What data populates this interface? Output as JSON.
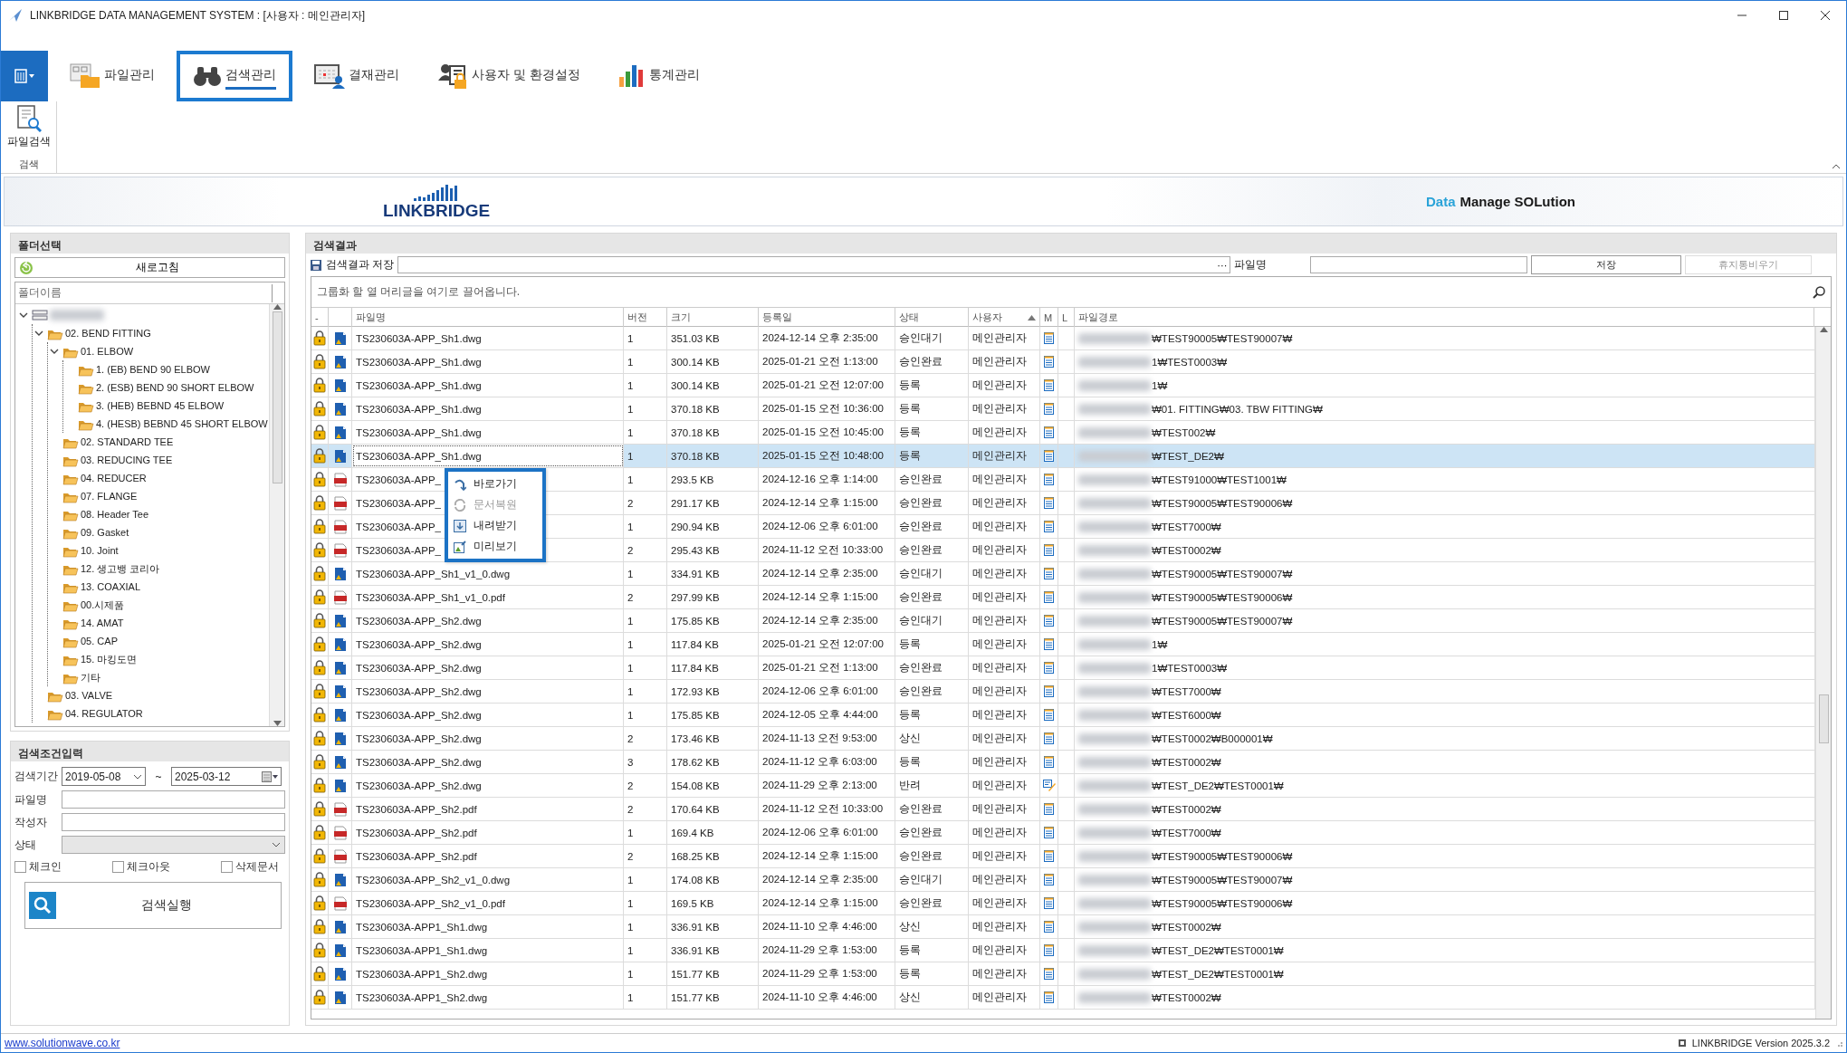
{
  "window": {
    "title": "LINKBRIDGE DATA MANAGEMENT SYSTEM : [사용자 : 메인관리자]"
  },
  "ribbon": {
    "tabs": [
      {
        "label": "파일관리",
        "kind": "files",
        "selected": false
      },
      {
        "label": "검색관리",
        "kind": "search",
        "selected": true
      },
      {
        "label": "결재관리",
        "kind": "approval",
        "selected": false
      },
      {
        "label": "사용자 및 환경설정",
        "kind": "users",
        "selected": false
      },
      {
        "label": "통계관리",
        "kind": "stats",
        "selected": false
      }
    ],
    "buttons": [
      {
        "label": "파일검색"
      }
    ],
    "group_label": "검색"
  },
  "banner": {
    "logo_text": "LINKBRIDGE",
    "tagline_prefix": "Data",
    "tagline": "Manage SOLution"
  },
  "folder_panel": {
    "title": "폴더선택",
    "refresh_button": "새로고침",
    "column_header": "폴더이름",
    "tree": [
      {
        "expanded": true,
        "children": [
          {
            "label": "02. BEND FITTING",
            "expanded": true,
            "children": [
              {
                "label": "01. ELBOW",
                "expanded": true,
                "children": [
                  {
                    "label": "1. (EB) BEND 90 ELBOW"
                  },
                  {
                    "label": "2. (ESB) BEND 90 SHORT ELBOW"
                  },
                  {
                    "label": "3. (HEB) BEBND 45 ELBOW"
                  },
                  {
                    "label": "4. (HESB) BEBND 45 SHORT ELBOW"
                  }
                ]
              },
              {
                "label": "02. STANDARD TEE"
              },
              {
                "label": "03. REDUCING TEE"
              },
              {
                "label": "04. REDUCER"
              },
              {
                "label": "07. FLANGE"
              },
              {
                "label": "08. Header Tee"
              },
              {
                "label": "09. Gasket"
              },
              {
                "label": "10. Joint"
              },
              {
                "label": "12. 생고뱅 코리아"
              },
              {
                "label": "13. COAXIAL"
              },
              {
                "label": "00.시제품"
              },
              {
                "label": "14. AMAT"
              },
              {
                "label": "05. CAP"
              },
              {
                "label": "15. 마킹도면"
              },
              {
                "label": "기타"
              }
            ]
          },
          {
            "label": "03. VALVE"
          },
          {
            "label": "04. REGULATOR"
          }
        ]
      }
    ]
  },
  "search_panel": {
    "title": "검색조건입력",
    "period_label": "검색기간",
    "date_from": "2019-05-08",
    "tilde": "~",
    "date_to": "2025-03-12",
    "filename_label": "파일명",
    "author_label": "작성자",
    "status_label": "상태",
    "status_disabled": true,
    "checkboxes": [
      {
        "label": "체크인",
        "checked": false
      },
      {
        "label": "체크아웃",
        "checked": false
      },
      {
        "label": "삭제문서",
        "checked": false
      }
    ],
    "run_button": "검색실행"
  },
  "results": {
    "title": "검색결과",
    "save_label": "검색결과 저장",
    "browse_button": "···",
    "filename_label": "파일명",
    "save_button": "저장",
    "empty_trash_button": "휴지통비우기",
    "empty_trash_disabled": true,
    "group_hint": "그룹화 할 열 머리글을 여기로 끌어옵니다.",
    "columns": [
      {
        "label": "-"
      },
      {
        "label": "파일명"
      },
      {
        "label": "버전"
      },
      {
        "label": "크기"
      },
      {
        "label": "등록일"
      },
      {
        "label": "상태"
      },
      {
        "label": "사용자",
        "sorted_ascending": true
      },
      {
        "label": "M"
      },
      {
        "label": "L"
      },
      {
        "label": "파일경로"
      }
    ],
    "rows": [
      {
        "kind": "dwg",
        "name": "TS230603A-APP_Sh1.dwg",
        "version": "1",
        "size": "351.03 KB",
        "date": "2024-12-14 오후 2:35:00",
        "state": "승인대기",
        "user": "메인관리자",
        "memo_edited": false,
        "path": "₩TEST90005₩TEST90007₩",
        "selected": false
      },
      {
        "kind": "dwg",
        "name": "TS230603A-APP_Sh1.dwg",
        "version": "1",
        "size": "300.14 KB",
        "date": "2025-01-21 오전 1:13:00",
        "state": "승인완료",
        "user": "메인관리자",
        "memo_edited": false,
        "path": "1₩TEST0003₩",
        "selected": false
      },
      {
        "kind": "dwg",
        "name": "TS230603A-APP_Sh1.dwg",
        "version": "1",
        "size": "300.14 KB",
        "date": "2025-01-21 오전 12:07:00",
        "state": "등록",
        "user": "메인관리자",
        "memo_edited": false,
        "path": "1₩",
        "selected": false
      },
      {
        "kind": "dwg",
        "name": "TS230603A-APP_Sh1.dwg",
        "version": "1",
        "size": "370.18 KB",
        "date": "2025-01-15 오전 10:36:00",
        "state": "등록",
        "user": "메인관리자",
        "memo_edited": false,
        "path": "₩01. FITTING₩03. TBW FITTING₩",
        "selected": false
      },
      {
        "kind": "dwg",
        "name": "TS230603A-APP_Sh1.dwg",
        "version": "1",
        "size": "370.18 KB",
        "date": "2025-01-15 오전 10:45:00",
        "state": "등록",
        "user": "메인관리자",
        "memo_edited": false,
        "path": "₩TEST002₩",
        "selected": false
      },
      {
        "kind": "dwg",
        "name": "TS230603A-APP_Sh1.dwg",
        "version": "1",
        "size": "370.18 KB",
        "date": "2025-01-15 오전 10:48:00",
        "state": "등록",
        "user": "메인관리자",
        "memo_edited": false,
        "path": "₩TEST_DE2₩",
        "selected": true
      },
      {
        "kind": "pdf",
        "name": "TS230603A-APP_",
        "version": "1",
        "size": "293.5 KB",
        "date": "2024-12-16 오후 1:14:00",
        "state": "승인완료",
        "user": "메인관리자",
        "memo_edited": false,
        "path": "₩TEST91000₩TEST1001₩",
        "selected": false
      },
      {
        "kind": "pdf",
        "name": "TS230603A-APP_",
        "version": "2",
        "size": "291.17 KB",
        "date": "2024-12-14 오후 1:15:00",
        "state": "승인완료",
        "user": "메인관리자",
        "memo_edited": false,
        "path": "₩TEST90005₩TEST90006₩",
        "selected": false
      },
      {
        "kind": "pdf",
        "name": "TS230603A-APP_",
        "version": "1",
        "size": "290.94 KB",
        "date": "2024-12-06 오후 6:01:00",
        "state": "승인완료",
        "user": "메인관리자",
        "memo_edited": false,
        "path": "₩TEST7000₩",
        "selected": false
      },
      {
        "kind": "pdf",
        "name": "TS230603A-APP_",
        "version": "2",
        "size": "295.43 KB",
        "date": "2024-11-12 오전 10:33:00",
        "state": "승인완료",
        "user": "메인관리자",
        "memo_edited": false,
        "path": "₩TEST0002₩",
        "selected": false
      },
      {
        "kind": "dwg",
        "name": "TS230603A-APP_Sh1_v1_0.dwg",
        "version": "1",
        "size": "334.91 KB",
        "date": "2024-12-14 오후 2:35:00",
        "state": "승인대기",
        "user": "메인관리자",
        "memo_edited": false,
        "path": "₩TEST90005₩TEST90007₩",
        "selected": false
      },
      {
        "kind": "pdf",
        "name": "TS230603A-APP_Sh1_v1_0.pdf",
        "version": "2",
        "size": "297.99 KB",
        "date": "2024-12-14 오후 1:15:00",
        "state": "승인완료",
        "user": "메인관리자",
        "memo_edited": false,
        "path": "₩TEST90005₩TEST90006₩",
        "selected": false
      },
      {
        "kind": "dwg",
        "name": "TS230603A-APP_Sh2.dwg",
        "version": "1",
        "size": "175.85 KB",
        "date": "2024-12-14 오후 2:35:00",
        "state": "승인대기",
        "user": "메인관리자",
        "memo_edited": false,
        "path": "₩TEST90005₩TEST90007₩",
        "selected": false
      },
      {
        "kind": "dwg",
        "name": "TS230603A-APP_Sh2.dwg",
        "version": "1",
        "size": "117.84 KB",
        "date": "2025-01-21 오전 12:07:00",
        "state": "등록",
        "user": "메인관리자",
        "memo_edited": false,
        "path": "1₩",
        "selected": false
      },
      {
        "kind": "dwg",
        "name": "TS230603A-APP_Sh2.dwg",
        "version": "1",
        "size": "117.84 KB",
        "date": "2025-01-21 오전 1:13:00",
        "state": "승인완료",
        "user": "메인관리자",
        "memo_edited": false,
        "path": "1₩TEST0003₩",
        "selected": false
      },
      {
        "kind": "dwg",
        "name": "TS230603A-APP_Sh2.dwg",
        "version": "1",
        "size": "172.93 KB",
        "date": "2024-12-06 오후 6:01:00",
        "state": "승인완료",
        "user": "메인관리자",
        "memo_edited": false,
        "path": "₩TEST7000₩",
        "selected": false
      },
      {
        "kind": "dwg",
        "name": "TS230603A-APP_Sh2.dwg",
        "version": "1",
        "size": "175.85 KB",
        "date": "2024-12-05 오후 4:44:00",
        "state": "등록",
        "user": "메인관리자",
        "memo_edited": false,
        "path": "₩TEST6000₩",
        "selected": false
      },
      {
        "kind": "dwg",
        "name": "TS230603A-APP_Sh2.dwg",
        "version": "2",
        "size": "173.46 KB",
        "date": "2024-11-13 오전 9:53:00",
        "state": "상신",
        "user": "메인관리자",
        "memo_edited": false,
        "path": "₩TEST0002₩B000001₩",
        "selected": false
      },
      {
        "kind": "dwg",
        "name": "TS230603A-APP_Sh2.dwg",
        "version": "3",
        "size": "178.62 KB",
        "date": "2024-11-12 오후 6:03:00",
        "state": "등록",
        "user": "메인관리자",
        "memo_edited": false,
        "path": "₩TEST0002₩",
        "selected": false
      },
      {
        "kind": "dwg",
        "name": "TS230603A-APP_Sh2.dwg",
        "version": "2",
        "size": "154.08 KB",
        "date": "2024-11-29 오후 2:13:00",
        "state": "반려",
        "user": "메인관리자",
        "memo_edited": true,
        "path": "₩TEST_DE2₩TEST0001₩",
        "selected": false
      },
      {
        "kind": "pdf",
        "name": "TS230603A-APP_Sh2.pdf",
        "version": "2",
        "size": "170.64 KB",
        "date": "2024-11-12 오전 10:33:00",
        "state": "승인완료",
        "user": "메인관리자",
        "memo_edited": false,
        "path": "₩TEST0002₩",
        "selected": false
      },
      {
        "kind": "pdf",
        "name": "TS230603A-APP_Sh2.pdf",
        "version": "1",
        "size": "169.4 KB",
        "date": "2024-12-06 오후 6:01:00",
        "state": "승인완료",
        "user": "메인관리자",
        "memo_edited": false,
        "path": "₩TEST7000₩",
        "selected": false
      },
      {
        "kind": "pdf",
        "name": "TS230603A-APP_Sh2.pdf",
        "version": "2",
        "size": "168.25 KB",
        "date": "2024-12-14 오후 1:15:00",
        "state": "승인완료",
        "user": "메인관리자",
        "memo_edited": false,
        "path": "₩TEST90005₩TEST90006₩",
        "selected": false
      },
      {
        "kind": "dwg",
        "name": "TS230603A-APP_Sh2_v1_0.dwg",
        "version": "1",
        "size": "174.08 KB",
        "date": "2024-12-14 오후 2:35:00",
        "state": "승인대기",
        "user": "메인관리자",
        "memo_edited": false,
        "path": "₩TEST90005₩TEST90007₩",
        "selected": false
      },
      {
        "kind": "pdf",
        "name": "TS230603A-APP_Sh2_v1_0.pdf",
        "version": "1",
        "size": "169.5 KB",
        "date": "2024-12-14 오후 1:15:00",
        "state": "승인완료",
        "user": "메인관리자",
        "memo_edited": false,
        "path": "₩TEST90005₩TEST90006₩",
        "selected": false
      },
      {
        "kind": "dwg",
        "name": "TS230603A-APP1_Sh1.dwg",
        "version": "1",
        "size": "336.91 KB",
        "date": "2024-11-10 오후 4:46:00",
        "state": "상신",
        "user": "메인관리자",
        "memo_edited": false,
        "path": "₩TEST0002₩",
        "selected": false
      },
      {
        "kind": "dwg",
        "name": "TS230603A-APP1_Sh1.dwg",
        "version": "1",
        "size": "336.91 KB",
        "date": "2024-11-29 오후 1:53:00",
        "state": "등록",
        "user": "메인관리자",
        "memo_edited": false,
        "path": "₩TEST_DE2₩TEST0001₩",
        "selected": false
      },
      {
        "kind": "dwg",
        "name": "TS230603A-APP1_Sh2.dwg",
        "version": "1",
        "size": "151.77 KB",
        "date": "2024-11-29 오후 1:53:00",
        "state": "등록",
        "user": "메인관리자",
        "memo_edited": false,
        "path": "₩TEST_DE2₩TEST0001₩",
        "selected": false
      },
      {
        "kind": "dwg",
        "name": "TS230603A-APP1_Sh2.dwg",
        "version": "1",
        "size": "151.77 KB",
        "date": "2024-11-10 오후 4:46:00",
        "state": "상신",
        "user": "메인관리자",
        "memo_edited": false,
        "path": "₩TEST0002₩",
        "selected": false
      }
    ],
    "context_menu": {
      "items": [
        {
          "label": "바로가기",
          "kind": "goto",
          "disabled": false
        },
        {
          "label": "문서복원",
          "kind": "restore",
          "disabled": true
        },
        {
          "label": "내려받기",
          "kind": "download",
          "disabled": false
        },
        {
          "label": "미리보기",
          "kind": "preview",
          "disabled": false
        }
      ]
    }
  },
  "status_bar": {
    "link": "www.solutionwave.co.kr",
    "version": "LINKBRIDGE Version 2025.3.2"
  }
}
